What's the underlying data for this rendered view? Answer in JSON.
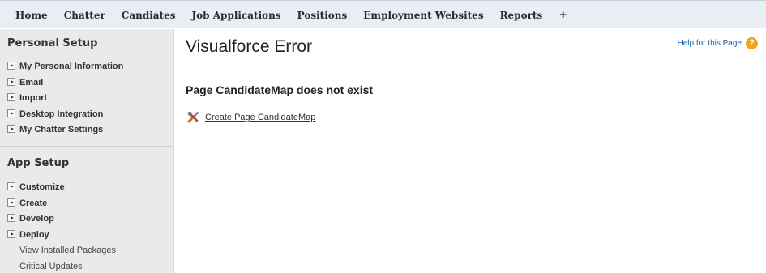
{
  "nav": {
    "tabs": [
      "Home",
      "Chatter",
      "Candiates",
      "Job Applications",
      "Positions",
      "Employment Websites",
      "Reports"
    ],
    "add_tab": "+"
  },
  "sidebar": {
    "personal_setup": {
      "title": "Personal Setup",
      "items": [
        "My Personal Information",
        "Email",
        "Import",
        "Desktop Integration",
        "My Chatter Settings"
      ]
    },
    "app_setup": {
      "title": "App Setup",
      "expandable_items": [
        "Customize",
        "Create",
        "Develop",
        "Deploy"
      ],
      "links": [
        "View Installed Packages",
        "Critical Updates"
      ]
    }
  },
  "main": {
    "title": "Visualforce Error",
    "help_link": "Help for this Page",
    "error_message": "Page CandidateMap does not exist",
    "create_link": "Create Page CandidateMap"
  },
  "colors": {
    "nav_bg": "#e8eef4",
    "sidebar_bg": "#eaeaea",
    "help_link": "#1a5ea8",
    "help_icon": "#f1a51c"
  }
}
